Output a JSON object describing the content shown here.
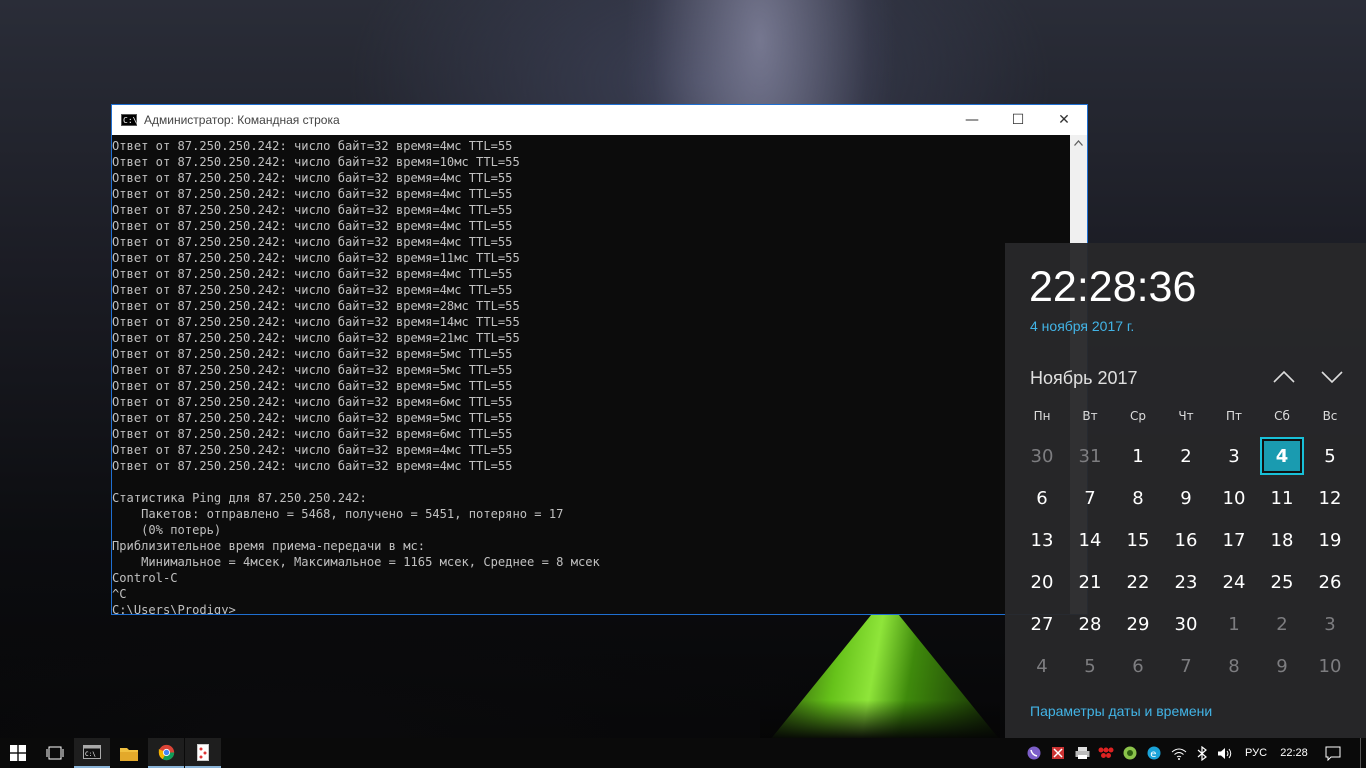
{
  "window": {
    "title": "Администратор: Командная строка",
    "icon_label": "C:\\.",
    "min_glyph": "—",
    "max_glyph": "☐",
    "close_glyph": "✕"
  },
  "console": {
    "lines": [
      "Ответ от 87.250.250.242: число байт=32 время=4мс TTL=55",
      "Ответ от 87.250.250.242: число байт=32 время=10мс TTL=55",
      "Ответ от 87.250.250.242: число байт=32 время=4мс TTL=55",
      "Ответ от 87.250.250.242: число байт=32 время=4мс TTL=55",
      "Ответ от 87.250.250.242: число байт=32 время=4мс TTL=55",
      "Ответ от 87.250.250.242: число байт=32 время=4мс TTL=55",
      "Ответ от 87.250.250.242: число байт=32 время=4мс TTL=55",
      "Ответ от 87.250.250.242: число байт=32 время=11мс TTL=55",
      "Ответ от 87.250.250.242: число байт=32 время=4мс TTL=55",
      "Ответ от 87.250.250.242: число байт=32 время=4мс TTL=55",
      "Ответ от 87.250.250.242: число байт=32 время=28мс TTL=55",
      "Ответ от 87.250.250.242: число байт=32 время=14мс TTL=55",
      "Ответ от 87.250.250.242: число байт=32 время=21мс TTL=55",
      "Ответ от 87.250.250.242: число байт=32 время=5мс TTL=55",
      "Ответ от 87.250.250.242: число байт=32 время=5мс TTL=55",
      "Ответ от 87.250.250.242: число байт=32 время=5мс TTL=55",
      "Ответ от 87.250.250.242: число байт=32 время=6мс TTL=55",
      "Ответ от 87.250.250.242: число байт=32 время=5мс TTL=55",
      "Ответ от 87.250.250.242: число байт=32 время=6мс TTL=55",
      "Ответ от 87.250.250.242: число байт=32 время=4мс TTL=55",
      "Ответ от 87.250.250.242: число байт=32 время=4мс TTL=55",
      "",
      "Статистика Ping для 87.250.250.242:",
      "    Пакетов: отправлено = 5468, получено = 5451, потеряно = 17",
      "    (0% потерь)",
      "Приблизительное время приема-передачи в мс:",
      "    Минимальное = 4мсек, Максимальное = 1165 мсек, Среднее = 8 мсек",
      "Control-C",
      "^C",
      "C:\\Users\\Prodigy>"
    ]
  },
  "clock": {
    "time": "22:28:36",
    "date": "4 ноября 2017 г.",
    "month_label": "Ноябрь 2017",
    "weekdays": [
      "Пн",
      "Вт",
      "Ср",
      "Чт",
      "Пт",
      "Сб",
      "Вс"
    ],
    "days": [
      {
        "d": "30",
        "other": true
      },
      {
        "d": "31",
        "other": true
      },
      {
        "d": "1"
      },
      {
        "d": "2"
      },
      {
        "d": "3"
      },
      {
        "d": "4",
        "today": true
      },
      {
        "d": "5"
      },
      {
        "d": "6"
      },
      {
        "d": "7"
      },
      {
        "d": "8"
      },
      {
        "d": "9"
      },
      {
        "d": "10"
      },
      {
        "d": "11"
      },
      {
        "d": "12"
      },
      {
        "d": "13"
      },
      {
        "d": "14"
      },
      {
        "d": "15"
      },
      {
        "d": "16"
      },
      {
        "d": "17"
      },
      {
        "d": "18"
      },
      {
        "d": "19"
      },
      {
        "d": "20"
      },
      {
        "d": "21"
      },
      {
        "d": "22"
      },
      {
        "d": "23"
      },
      {
        "d": "24"
      },
      {
        "d": "25"
      },
      {
        "d": "26"
      },
      {
        "d": "27"
      },
      {
        "d": "28"
      },
      {
        "d": "29"
      },
      {
        "d": "30"
      },
      {
        "d": "1",
        "other": true
      },
      {
        "d": "2",
        "other": true
      },
      {
        "d": "3",
        "other": true
      },
      {
        "d": "4",
        "other": true
      },
      {
        "d": "5",
        "other": true
      },
      {
        "d": "6",
        "other": true
      },
      {
        "d": "7",
        "other": true
      },
      {
        "d": "8",
        "other": true
      },
      {
        "d": "9",
        "other": true
      },
      {
        "d": "10",
        "other": true
      }
    ],
    "settings_link": "Параметры даты и времени",
    "accent_color": "#42b4e6",
    "today_color": "#1a9bb0"
  },
  "taskbar": {
    "pinned": [
      "windows-start-icon",
      "task-view-icon",
      "cmd-icon",
      "file-explorer-icon",
      "chrome-icon",
      "app-icon"
    ],
    "tray_icons": [
      "viber-icon",
      "tray-app-icon",
      "printer-icon",
      "tray-app2-icon",
      "tray-app3-icon",
      "ie-icon",
      "wifi-icon",
      "bluetooth-icon",
      "volume-icon"
    ],
    "language": "РУС",
    "time": "22:28"
  }
}
